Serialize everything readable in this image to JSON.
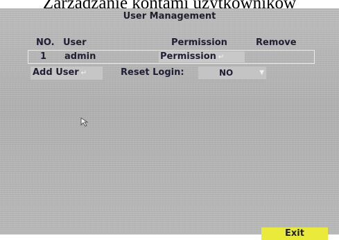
{
  "caption": "Zarządzanie kontami użytkowników",
  "window": {
    "title": "User Management"
  },
  "table": {
    "headers": {
      "no": "NO.",
      "user": "User",
      "permission": "Permission",
      "remove": "Remove"
    },
    "rows": [
      {
        "no": "1",
        "user": "admin",
        "permission": "Permission",
        "remove": ""
      }
    ]
  },
  "actions": {
    "add_user_label": "Add User",
    "reset_login_label": "Reset Login:",
    "reset_login_value": "NO",
    "exit_label": "Exit"
  },
  "colors": {
    "screen_bg": "#b8b8b8",
    "exit_button": "#eaea3a",
    "text": "#1f1f33"
  },
  "icons": {
    "enter": "enter-icon",
    "dropdown": "dropdown-arrow-icon",
    "cursor": "mouse-cursor-icon"
  }
}
